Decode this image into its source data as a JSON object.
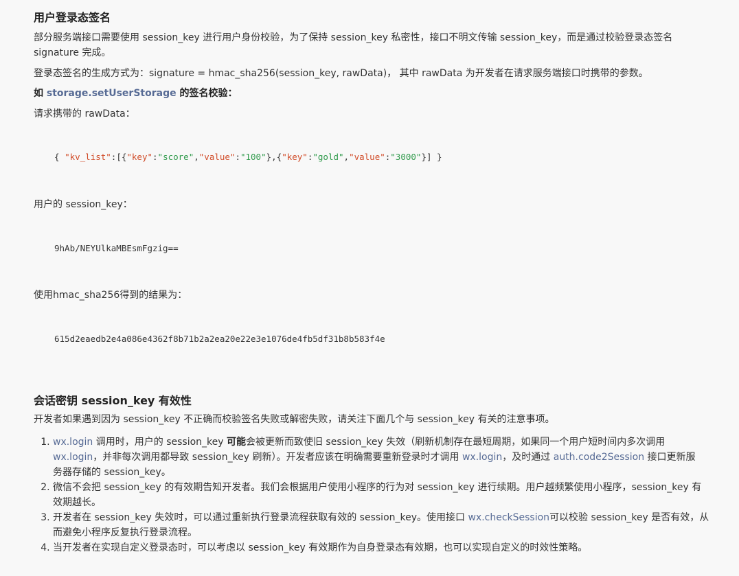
{
  "section1": {
    "title": "用户登录态签名",
    "p1_line1": "部分服务端接口需要使用 session_key 进行用户身份校验，为了保持 session_key 私密性，接口不明文传输 session_key，而是通过校验登录态签名",
    "p1_line2": "signature 完成。",
    "p2": "登录态签名的生成方式为：signature = hmac_sha256(session_key, rawData)， 其中 rawData 为开发者在请求服务端接口时携带的参数。",
    "example_prefix": "如 ",
    "example_link": "storage.setUserStorage",
    "example_suffix": " 的签名校验：",
    "raw_label": "请求携带的 rawData：",
    "raw_json": {
      "open": "{ ",
      "kv_key": "\"kv_list\"",
      "colon1": ":[{",
      "k1": "\"key\"",
      "c1": ":",
      "v1": "\"score\"",
      "sep1": ",",
      "k2": "\"value\"",
      "c2": ":",
      "v2": "\"100\"",
      "mid": "},{",
      "k3": "\"key\"",
      "c3": ":",
      "v3": "\"gold\"",
      "sep2": ",",
      "k4": "\"value\"",
      "c4": ":",
      "v4": "\"3000\"",
      "close": "}] }"
    },
    "session_label": "用户的 session_key：",
    "session_value": "9hAb/NEYUlkaMBEsmFgzig==",
    "result_label": "使用hmac_sha256得到的结果为：",
    "result_value": "615d2eaedb2e4a086e4362f8b71b2a2ea20e22e3e1076de4fb5df31b8b583f4e"
  },
  "section2": {
    "title": "会话密钥 session_key 有效性",
    "intro": "开发者如果遇到因为 session_key 不正确而校验签名失败或解密失败，请关注下面几个与 session_key 有关的注意事项。",
    "item1": {
      "link_a": "wx.login",
      "text_a": " 调用时，用户的 session_key ",
      "bold": "可能",
      "text_b": "会被更新而致使旧 session_key 失效（刷新机制存在最短周期，如果同一个用户短时间内多次调用",
      "link_b": "wx.login",
      "text_c": "，并非每次调用都导致 session_key 刷新）。开发者应该在明确需要重新登录时才调用 ",
      "link_c": "wx.login",
      "text_d": "，及时通过 ",
      "link_d": "auth.code2Session",
      "text_e": " 接口更新服",
      "text_f": "务器存储的 session_key。"
    },
    "item2_line1": "微信不会把 session_key 的有效期告知开发者。我们会根据用户使用小程序的行为对 session_key 进行续期。用户越频繁使用小程序，session_key 有",
    "item2_line2": "效期越长。",
    "item3": {
      "text_a": "开发者在 session_key 失效时，可以通过重新执行登录流程获取有效的 session_key。使用接口 ",
      "link": "wx.checkSession",
      "text_b": "可以校验 session_key 是否有效，从",
      "text_c": "而避免小程序反复执行登录流程。"
    },
    "item4": "当开发者在实现自定义登录态时，可以考虑以 session_key 有效期作为自身登录态有效期，也可以实现自定义的时效性策略。"
  }
}
